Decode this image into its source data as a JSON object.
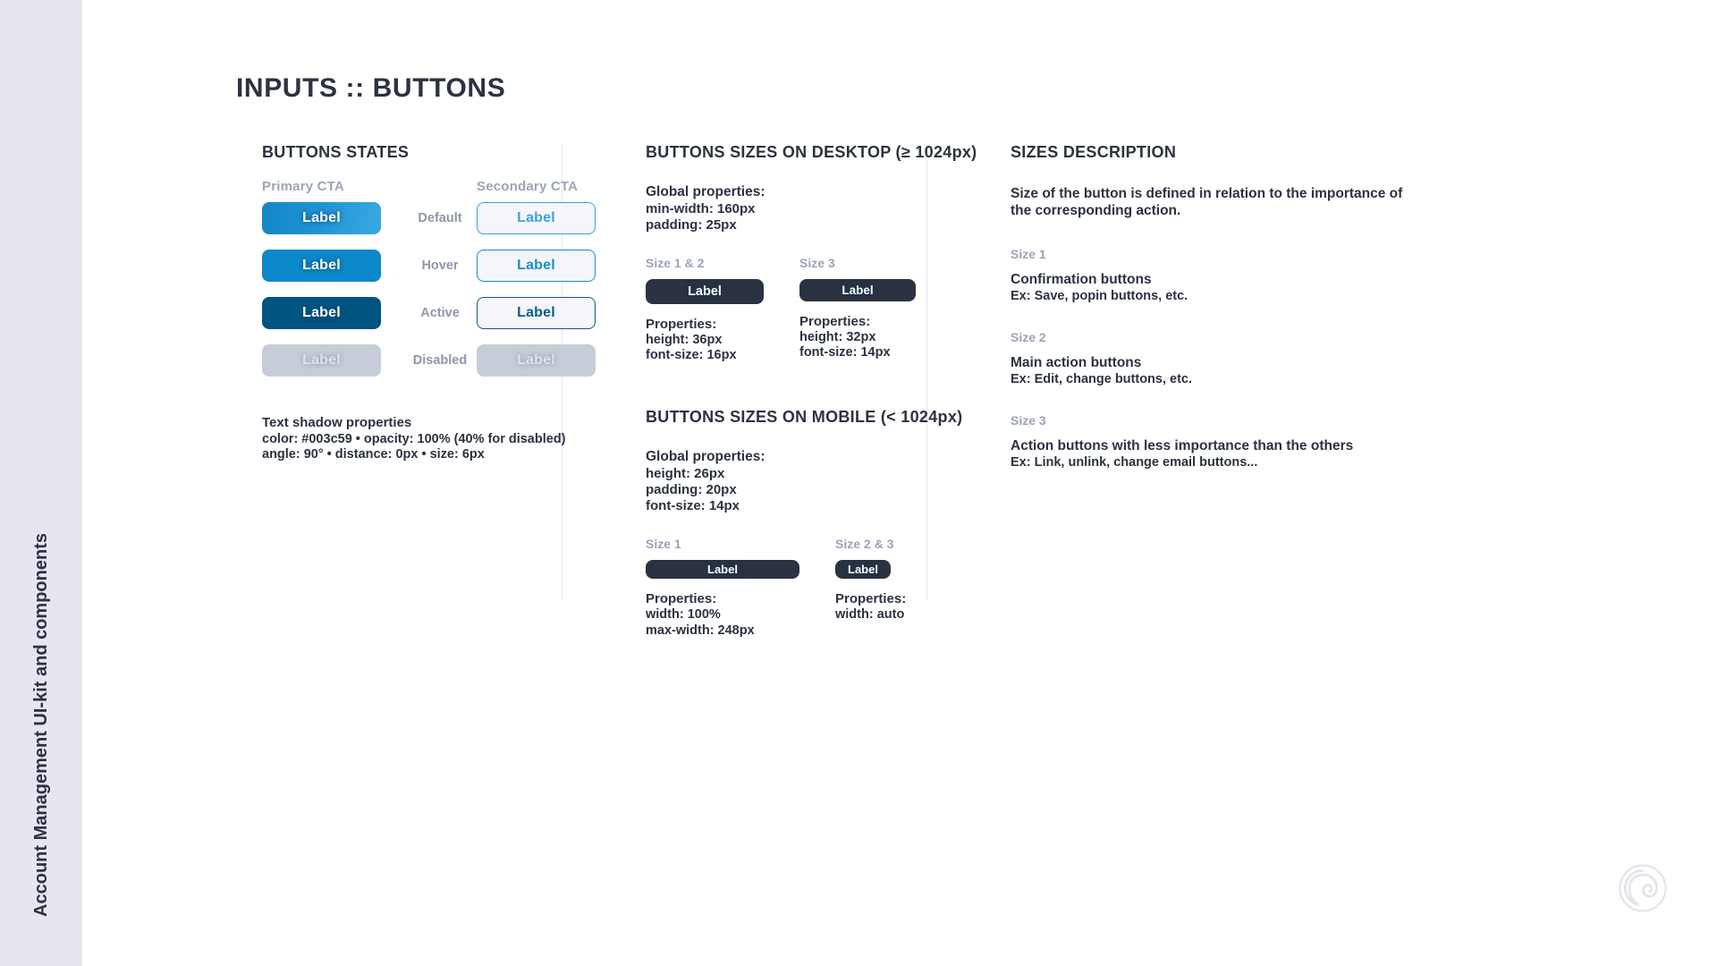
{
  "sidebar": {
    "label": "Account Management UI-kit and components"
  },
  "page": {
    "title": "INPUTS :: BUTTONS"
  },
  "buttons_states": {
    "section_title": "BUTTONS STATES",
    "primary_head": "Primary CTA",
    "secondary_head": "Secondary CTA",
    "button_label": "Label",
    "states": [
      {
        "name": "Default"
      },
      {
        "name": "Hover"
      },
      {
        "name": "Active"
      },
      {
        "name": "Disabled"
      }
    ],
    "text_shadow": {
      "heading": "Text shadow properties",
      "line1": "color: #003c59 • opacity: 100% (40% for disabled)",
      "line2": "angle: 90° • distance: 0px • size: 6px"
    }
  },
  "desktop_sizes": {
    "section_title": "BUTTONS SIZES ON DESKTOP (≥ 1024px)",
    "global": {
      "heading": "Global properties:",
      "line1": "min-width: 160px",
      "line2": "padding: 25px"
    },
    "cells": [
      {
        "tag": "Size 1 & 2",
        "button_label": "Label",
        "props_heading": "Properties:",
        "props_line1": "height: 36px",
        "props_line2": "font-size: 16px"
      },
      {
        "tag": "Size 3",
        "button_label": "Label",
        "props_heading": "Properties:",
        "props_line1": "height: 32px",
        "props_line2": "font-size: 14px"
      }
    ]
  },
  "mobile_sizes": {
    "section_title": "BUTTONS SIZES ON MOBILE (< 1024px)",
    "global": {
      "heading": "Global properties:",
      "line1": "height: 26px",
      "line2": "padding: 20px",
      "line3": "font-size: 14px"
    },
    "cells": [
      {
        "tag": "Size 1",
        "button_label": "Label",
        "props_heading": "Properties:",
        "props_line1": "width: 100%",
        "props_line2": "max-width: 248px"
      },
      {
        "tag": "Size 2 & 3",
        "button_label": "Label",
        "props_heading": "Properties:",
        "props_line1": "width: auto",
        "props_line2": ""
      }
    ]
  },
  "sizes_description": {
    "section_title": "SIZES DESCRIPTION",
    "intro_line1": "Size of the button is defined in relation to the importance of",
    "intro_line2": "the corresponding action.",
    "items": [
      {
        "tag": "Size 1",
        "title": "Confirmation buttons",
        "example": "Ex: Save, popin buttons, etc."
      },
      {
        "tag": "Size 2",
        "title": "Main action buttons",
        "example": "Ex: Edit, change buttons, etc."
      },
      {
        "tag": "Size 3",
        "title": "Action buttons with less importance than the others",
        "example": "Ex: Link, unlink, change email buttons..."
      }
    ]
  },
  "colors": {
    "primary_gradient_start": "#1586c8",
    "primary_gradient_end": "#3aa9e2",
    "primary_hover": "#0d88ca",
    "primary_active": "#005580",
    "disabled": "#c7cdd8",
    "secondary_border": "#3aa3de",
    "dark": "#2b3241",
    "muted": "#9aa4b8",
    "sidebar_bg": "#e7e6f0",
    "text_shadow_color": "#003c59"
  }
}
